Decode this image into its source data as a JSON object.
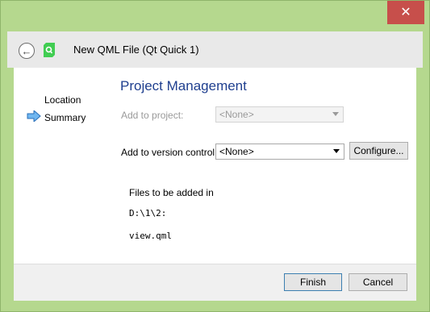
{
  "window": {
    "title": "New QML File (Qt Quick 1)",
    "close_glyph": "✕",
    "back_icon": "back-arrow-icon",
    "app_icon": "qt-creator-icon"
  },
  "wizard": {
    "steps": [
      {
        "label": "Location",
        "active": false
      },
      {
        "label": "Summary",
        "active": true
      }
    ],
    "current_step_icon": "right-arrow-icon"
  },
  "page": {
    "heading": "Project Management",
    "add_to_project": {
      "label": "Add to project:",
      "value": "<None>",
      "enabled": false
    },
    "add_to_vcs": {
      "label": "Add to version control:",
      "value": "<None>",
      "enabled": true
    },
    "configure_label": "Configure...",
    "files_heading": "Files to be added in",
    "directory": "D:\\1\\2:",
    "files": [
      "view.qml"
    ]
  },
  "footer": {
    "finish_label": "Finish",
    "cancel_label": "Cancel"
  },
  "colors": {
    "frame": "#b5d88e",
    "close_button": "#c74f4b",
    "heading": "#1f3f8f",
    "step_arrow": "#3a8ee6"
  }
}
